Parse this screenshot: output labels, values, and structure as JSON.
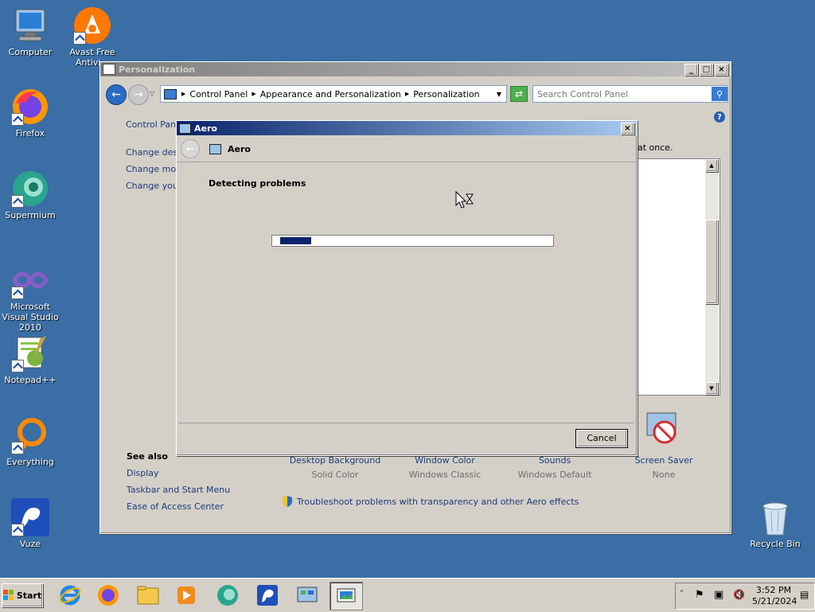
{
  "desktop_icons": [
    {
      "name": "computer",
      "label": "Computer"
    },
    {
      "name": "avast",
      "label": "Avast Free Antivi..."
    },
    {
      "name": "firefox",
      "label": "Firefox"
    },
    {
      "name": "supermium",
      "label": "Supermium"
    },
    {
      "name": "visual-studio",
      "label": "Microsoft Visual Studio 2010"
    },
    {
      "name": "notepadpp",
      "label": "Notepad++"
    },
    {
      "name": "everything",
      "label": "Everything"
    },
    {
      "name": "vuze",
      "label": "Vuze"
    },
    {
      "name": "recycle-bin",
      "label": "Recycle Bin"
    }
  ],
  "personalization": {
    "title": "Personalization",
    "breadcrumb": [
      "Control Panel",
      "Appearance and Personalization",
      "Personalization"
    ],
    "search_placeholder": "Search Control Panel",
    "left_links": {
      "home": "Control Panel",
      "l1": "Change deskt",
      "l2": "Change mous",
      "l3": "Change your"
    },
    "visible_text": "at once.",
    "see_also": {
      "heading": "See also",
      "items": [
        "Display",
        "Taskbar and Start Menu",
        "Ease of Access Center"
      ]
    },
    "bottom_items": [
      {
        "title": "Desktop Background",
        "value": "Solid Color"
      },
      {
        "title": "Window Color",
        "value": "Windows Classic"
      },
      {
        "title": "Sounds",
        "value": "Windows Default"
      },
      {
        "title": "Screen Saver",
        "value": "None"
      }
    ],
    "troubleshoot": "Troubleshoot problems with transparency and other Aero effects"
  },
  "aero_dialog": {
    "title": "Aero",
    "header": "Aero",
    "status": "Detecting problems",
    "progress": 0.11,
    "cancel": "Cancel"
  },
  "taskbar": {
    "start": "Start",
    "time": "3:52 PM",
    "date": "5/21/2024"
  },
  "colors": {
    "desktop": "#3a6ea5",
    "face": "#d4d0c8",
    "progress": "#0a246a",
    "active_title": "#0a246a"
  }
}
